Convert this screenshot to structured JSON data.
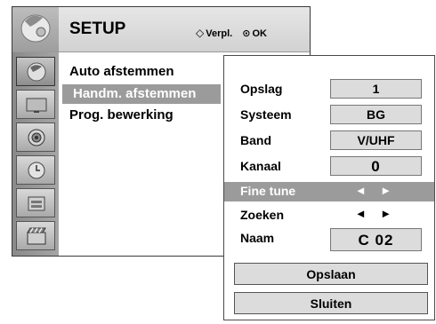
{
  "header": {
    "title": "SETUP",
    "hint_move": "Verpl.",
    "hint_ok": "OK"
  },
  "sidebar": {
    "icons": [
      "setup-icon",
      "picture-icon",
      "audio-icon",
      "time-icon",
      "option-icon",
      "lock-icon"
    ],
    "active_index": 0
  },
  "menu": {
    "items": [
      "Auto afstemmen",
      "Handm. afstemmen",
      "Prog. bewerking"
    ],
    "selected_index": 1
  },
  "panel": {
    "rows": [
      {
        "label": "Opslag",
        "value": "1"
      },
      {
        "label": "Systeem",
        "value": "BG"
      },
      {
        "label": "Band",
        "value": "V/UHF"
      },
      {
        "label": "Kanaal",
        "value": "0"
      },
      {
        "label": "Fine tune",
        "value": "◄ ►"
      },
      {
        "label": "Zoeken",
        "value": "◄ ►"
      },
      {
        "label": "Naam",
        "value": "C 02"
      }
    ],
    "highlighted_index": 4,
    "save_button": "Opslaan",
    "close_button": "Sluiten"
  },
  "colors": {
    "highlight": "#9b9b9b",
    "value_box": "#dcdcdc",
    "sidebar": "#9a9a9a"
  }
}
